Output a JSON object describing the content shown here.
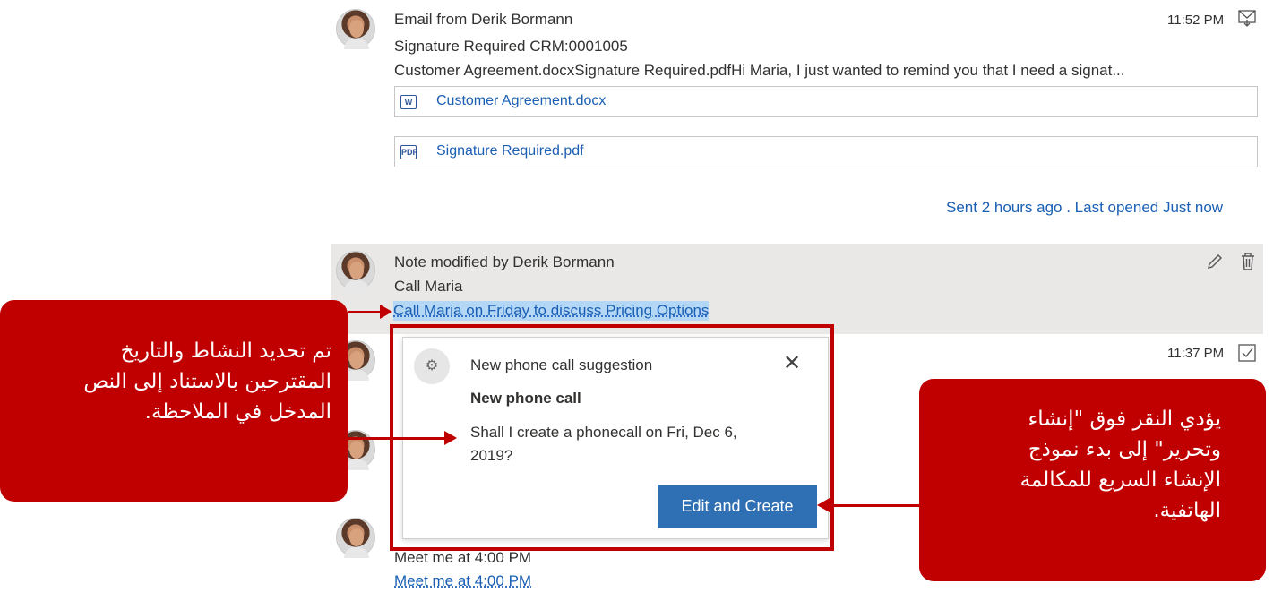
{
  "email": {
    "title": "Email from Derik Bormann",
    "time": "11:52 PM",
    "subject": "Signature Required CRM:0001005",
    "preview": "Customer Agreement.docxSignature Required.pdfHi Maria, I just wanted to remind you that I need a signat...",
    "attachments": [
      {
        "name": "Customer Agreement.docx",
        "icon": "word-doc-icon"
      },
      {
        "name": "Signature Required.pdf",
        "icon": "pdf-icon"
      }
    ],
    "status": "Sent 2 hours ago . Last opened Just now"
  },
  "note": {
    "title": "Note modified by Derik Bormann",
    "subject": "Call Maria",
    "body": "Call Maria on Friday to discuss Pricing Options"
  },
  "task": {
    "time": "11:37 PM"
  },
  "bottom_item": {
    "line1": "Meet me at 4:00 PM",
    "line2": "Meet me at 4:00 PM"
  },
  "suggestion": {
    "header": "New phone call suggestion",
    "title": "New phone call",
    "message_line1": "Shall I create a phonecall on Fri, Dec 6,",
    "message_line2": "2019?",
    "button": "Edit and Create"
  },
  "callouts": {
    "left": {
      "line1": "تم تحديد النشاط والتاريخ",
      "line2": "المقترحين بالاستناد إلى النص",
      "line3": "المدخل في الملاحظة."
    },
    "right": {
      "line1": "يؤدي النقر فوق \"إنشاء",
      "line2": "وتحرير\" إلى بدء نموذج",
      "line3": "الإنشاء السريع للمكالمة",
      "line4": "الهاتفية."
    }
  },
  "colors": {
    "annotation_red": "#c00000",
    "primary_button": "#2f6fb3",
    "link": "#1a5fb4",
    "highlight": "#b3d7f5"
  }
}
